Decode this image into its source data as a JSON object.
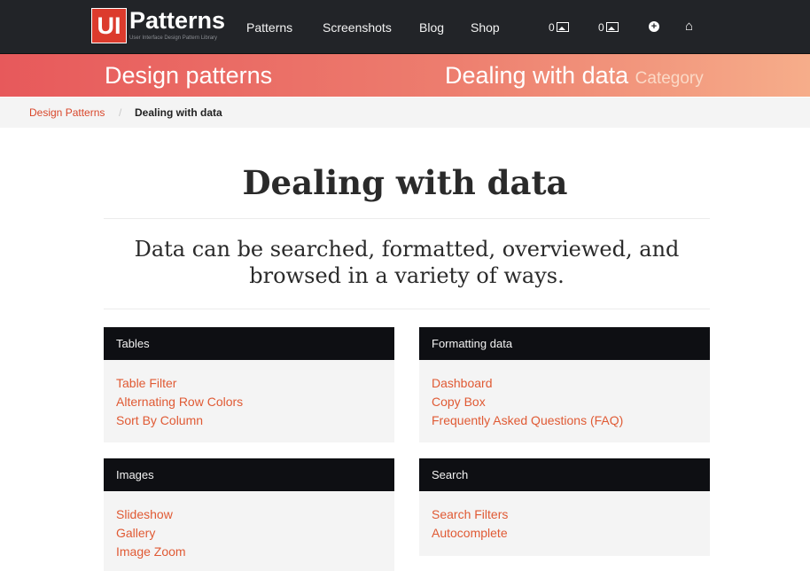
{
  "brand": {
    "logo_mark": "UI",
    "name": "Patterns",
    "tagline": "User Interface Design Pattern Library"
  },
  "nav": {
    "links": [
      "Patterns",
      "Screenshots",
      "Blog",
      "Shop"
    ],
    "counter_a": "0",
    "counter_b": "0",
    "icons": [
      "image-icon",
      "image-icon",
      "plus-circle-icon",
      "home-icon"
    ]
  },
  "banner": {
    "left": "Design patterns",
    "right": "Dealing with data",
    "right_suffix": "Category"
  },
  "breadcrumb": {
    "link": "Design Patterns",
    "separator": "/",
    "current": "Dealing with data"
  },
  "page": {
    "title": "Dealing with data",
    "lead": "Data can be searched, formatted, overviewed, and browsed in a variety of ways."
  },
  "panels": [
    {
      "title": "Tables",
      "links": [
        "Table Filter",
        "Alternating Row Colors",
        "Sort By Column"
      ]
    },
    {
      "title": "Formatting data",
      "links": [
        "Dashboard",
        "Copy Box",
        "Frequently Asked Questions (FAQ)"
      ]
    },
    {
      "title": "Images",
      "links": [
        "Slideshow",
        "Gallery",
        "Image Zoom"
      ]
    },
    {
      "title": "Search",
      "links": [
        "Search Filters",
        "Autocomplete"
      ]
    }
  ],
  "colors": {
    "accent": "#e05a34",
    "nav_bg": "#222428",
    "panel_head_bg": "#0e0f13",
    "banner_start": "#e7595b",
    "banner_end": "#f6ad8a"
  }
}
